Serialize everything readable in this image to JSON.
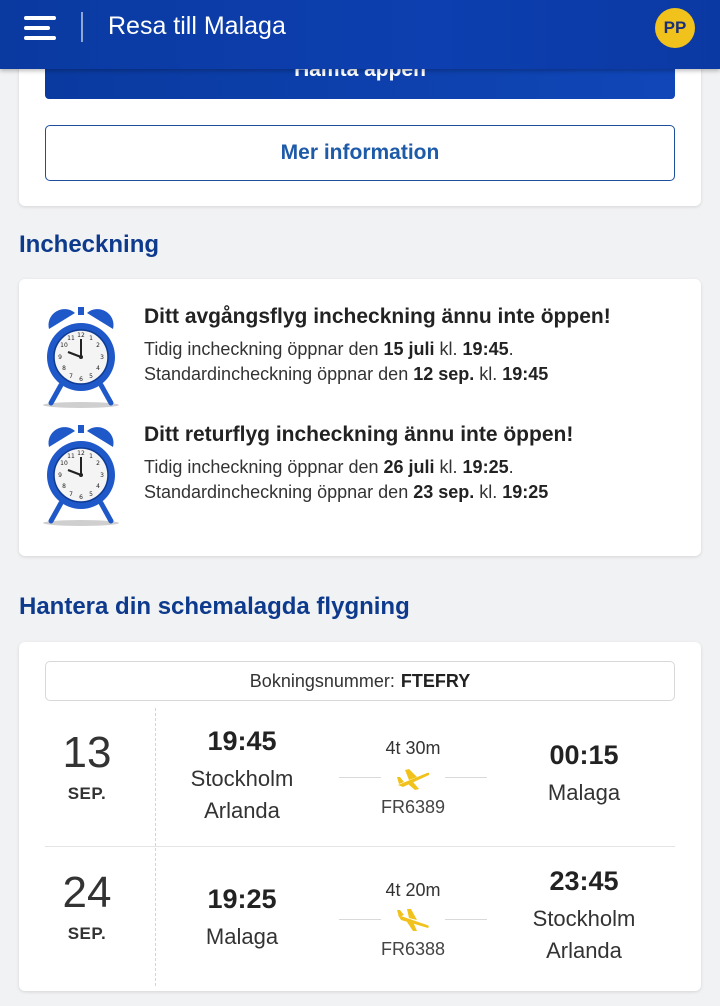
{
  "header": {
    "title": "Resa till Malaga",
    "avatar_initials": "PP"
  },
  "top_card": {
    "app_button_label": "Hämta appen",
    "info_button_label": "Mer information"
  },
  "checkin": {
    "section_title": "Incheckning",
    "items": [
      {
        "title": "Ditt avgångsflyg incheckning ännu inte öppen!",
        "early_prefix": "Tidig incheckning öppnar den ",
        "early_date": "15 juli",
        "early_mid": " kl. ",
        "early_time": "19:45",
        "early_suffix": ".",
        "std_prefix": "Standardincheckning öppnar den ",
        "std_date": "12 sep.",
        "std_mid": " kl. ",
        "std_time": "19:45"
      },
      {
        "title": "Ditt returflyg incheckning ännu inte öppen!",
        "early_prefix": "Tidig incheckning öppnar den ",
        "early_date": "26 juli",
        "early_mid": " kl. ",
        "early_time": "19:25",
        "early_suffix": ".",
        "std_prefix": "Standardincheckning öppnar den ",
        "std_date": "23 sep.",
        "std_mid": " kl. ",
        "std_time": "19:25"
      }
    ]
  },
  "flights": {
    "section_title": "Hantera din schemalagda flygning",
    "booking_label": "Bokningsnummer:",
    "booking_number": "FTEFRY",
    "rows": [
      {
        "day": "13",
        "month": "SEP.",
        "dep_time": "19:45",
        "dep_place_1": "Stockholm",
        "dep_place_2": "Arlanda",
        "duration": "4t 30m",
        "flight_no": "FR6389",
        "arr_time": "00:15",
        "arr_place_1": "Malaga",
        "arr_place_2": ""
      },
      {
        "day": "24",
        "month": "SEP.",
        "dep_time": "19:25",
        "dep_place_1": "Malaga",
        "dep_place_2": "",
        "duration": "4t 20m",
        "flight_no": "FR6388",
        "arr_time": "23:45",
        "arr_place_1": "Stockholm",
        "arr_place_2": "Arlanda"
      }
    ]
  },
  "colors": {
    "brand_blue": "#0d3fb0",
    "accent_yellow": "#f1c21b",
    "heading_blue": "#0d3a8c"
  },
  "icons": {
    "menu": "hamburger-icon",
    "clock": "alarm-clock-icon",
    "plane": "airplane-icon"
  }
}
